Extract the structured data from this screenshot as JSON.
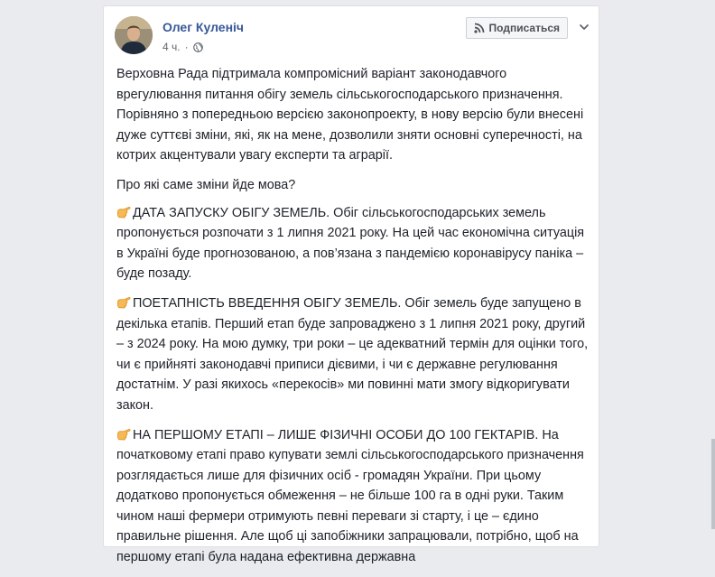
{
  "post": {
    "author": "Олег Куленіч",
    "time": "4 ч.",
    "follow_label": "Подписаться",
    "intro": "Верховна Рада підтримала компромісний варіант законодавчого врегулювання питання обігу земель сільськогосподарського призначення. Порівняно з попередньою версією законопроекту, в нову версію були внесені дуже суттєві зміни, які, як на мене, дозволили зняти основні суперечності, на котрих акцентували увагу експерти та аграрії.",
    "question": "Про які саме зміни йде мова?",
    "points": [
      "ДАТА ЗАПУСКУ ОБІГУ ЗЕМЕЛЬ. Обіг сільськогосподарських земель пропонується розпочати з 1 липня 2021 року. На цей час економічна ситуація в Україні буде прогнозованою, а пов’язана з пандемією коронавірусу паніка – буде позаду.",
      "ПОЕТАПНІСТЬ ВВЕДЕННЯ ОБІГУ ЗЕМЕЛЬ. Обіг земель буде запущено в декілька етапів. Перший етап буде запроваджено з 1 липня 2021 року, другий – з 2024 року. На мою думку, три роки – це адекватний термін для оцінки того, чи є прийняті законодавчі приписи дієвими, і чи є державне регулювання достатнім. У разі якихось «перекосів» ми повинні мати змогу відкоригувати закон.",
      "НА ПЕРШОМУ ЕТАПІ – ЛИШЕ ФІЗИЧНІ ОСОБИ ДО 100 ГЕКТАРІВ. На початковому етапі право купувати землі сільськогосподарського призначення розглядається лише для фізичних осіб - громадян України. При цьому додатково пропонується обмеження – не більше 100 га в одні руки. Таким чином наші фермери отримують певні переваги зі старту, і це – єдино правильне рішення. Але щоб ці запобіжники запрацювали, потрібно, щоб на першому етапі була надана ефективна державна"
    ]
  },
  "colors": {
    "link": "#385898",
    "text": "#1d2129",
    "meta": "#616770",
    "background": "#e9ebee"
  }
}
